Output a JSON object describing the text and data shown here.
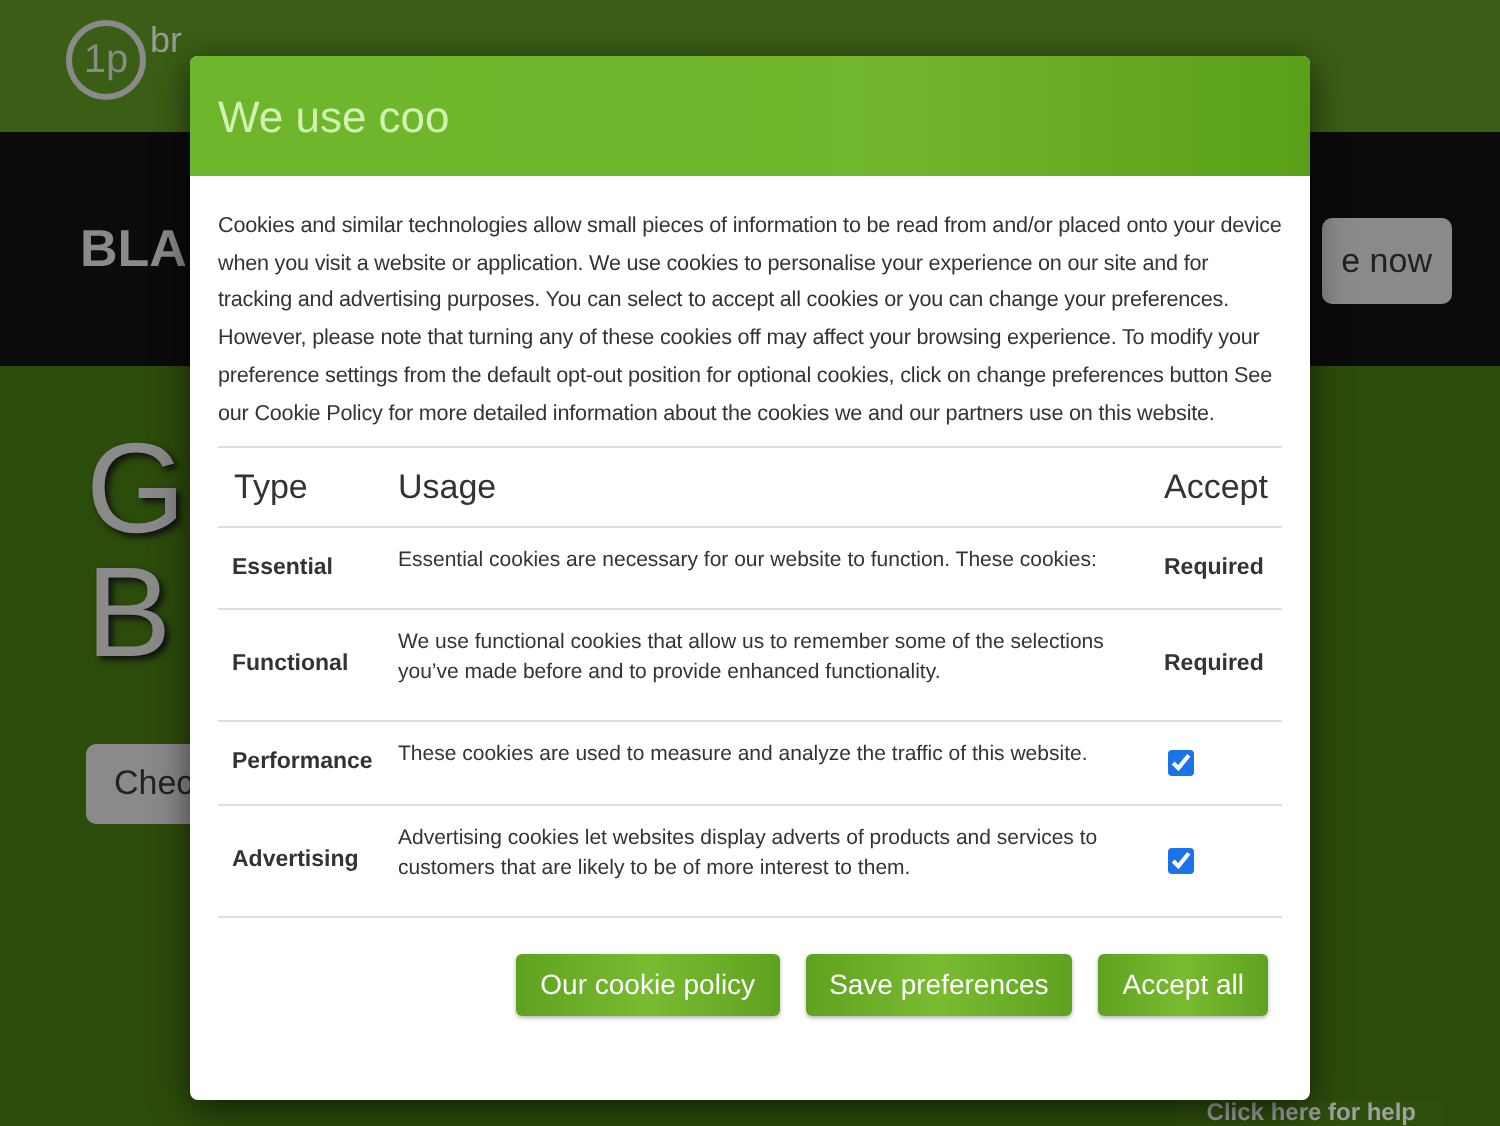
{
  "background_page": {
    "logo_text": "1p",
    "logo_word": "br",
    "banner_heading": "BLA",
    "banner_button": "e now",
    "hero_lines": [
      "G",
      "B"
    ],
    "hero_button": "Chec",
    "help_tab": "Click here for help"
  },
  "dialog": {
    "title": "We use coo",
    "intro": "Cookies and similar technologies allow small pieces of information to be read from and/or placed onto your device when you visit a website or application. We use cookies to personalise your experience on our site and for tracking and advertising purposes. You can select to accept all cookies or you can change your preferences. However, please note that turning any of these cookies off may affect your browsing experience. To modify your preference settings from the default opt-out position for optional cookies, click on change preferences button See our Cookie Policy for more detailed information about the cookies we and our partners use on this website.",
    "table": {
      "columns": [
        "Type",
        "Usage",
        "Accept"
      ],
      "rows": [
        {
          "type": "Essential",
          "usage": "Essential cookies are necessary for our website to function. These cookies:",
          "kind": "required",
          "accept": "Required"
        },
        {
          "type": "Functional",
          "usage": "We use functional cookies that allow us to remember some of the selections you’ve made before and to provide enhanced functionality.",
          "kind": "required",
          "accept": "Required"
        },
        {
          "type": "Performance",
          "usage": "These cookies are used to measure and analyze the traffic of this website.",
          "kind": "checkbox",
          "checked": true
        },
        {
          "type": "Advertising",
          "usage": "Advertising cookies let websites display adverts of products and services to customers that are likely to be of more interest to them.",
          "kind": "checkbox",
          "checked": true
        }
      ]
    },
    "buttons": [
      "Our cookie policy",
      "Save preferences",
      "Accept all"
    ]
  }
}
